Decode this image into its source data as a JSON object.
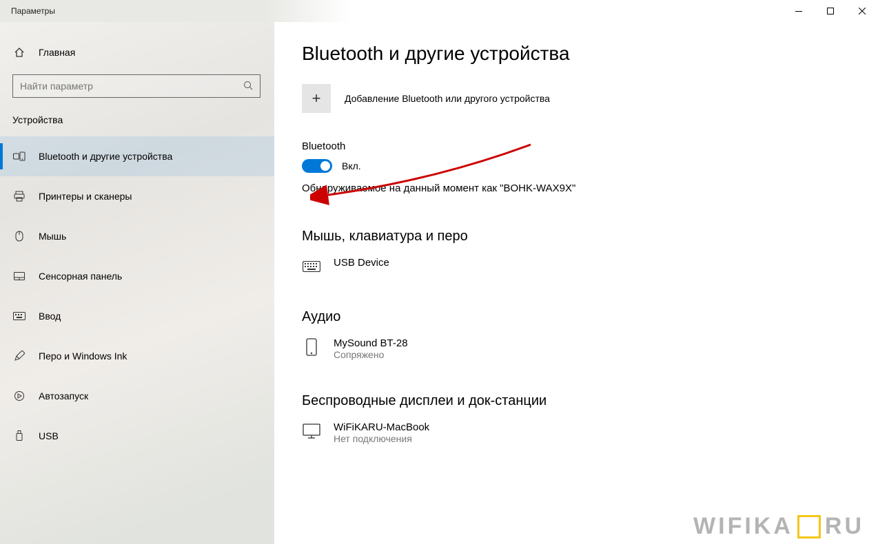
{
  "window": {
    "title": "Параметры"
  },
  "sidebar": {
    "home": "Главная",
    "search_placeholder": "Найти параметр",
    "category": "Устройства",
    "items": [
      {
        "label": "Bluetooth и другие устройства",
        "icon": "bluetooth-devices",
        "selected": true
      },
      {
        "label": "Принтеры и сканеры",
        "icon": "printer",
        "selected": false
      },
      {
        "label": "Мышь",
        "icon": "mouse",
        "selected": false
      },
      {
        "label": "Сенсорная панель",
        "icon": "touchpad",
        "selected": false
      },
      {
        "label": "Ввод",
        "icon": "keyboard",
        "selected": false
      },
      {
        "label": "Перо и Windows Ink",
        "icon": "pen",
        "selected": false
      },
      {
        "label": "Автозапуск",
        "icon": "autoplay",
        "selected": false
      },
      {
        "label": "USB",
        "icon": "usb",
        "selected": false
      }
    ]
  },
  "main": {
    "title": "Bluetooth и другие устройства",
    "add_device": "Добавление Bluetooth или другого устройства",
    "bluetooth_label": "Bluetooth",
    "toggle_state": "Вкл.",
    "toggle_on": true,
    "discoverable": "Обнаруживаемое на данный момент как \"BOHK-WAX9X\"",
    "sections": {
      "input_devices": {
        "heading": "Мышь, клавиатура и перо",
        "devices": [
          {
            "name": "USB Device",
            "status": "",
            "icon": "keyboard"
          }
        ]
      },
      "audio": {
        "heading": "Аудио",
        "devices": [
          {
            "name": "MySound BT-28",
            "status": "Сопряжено",
            "icon": "phone"
          }
        ]
      },
      "wireless": {
        "heading": "Беспроводные дисплеи и док-станции",
        "devices": [
          {
            "name": "WiFiKARU-MacBook",
            "status": "Нет подключения",
            "icon": "monitor"
          }
        ]
      }
    }
  },
  "watermark": "WIFIKA RU",
  "colors": {
    "accent": "#0078d7"
  }
}
